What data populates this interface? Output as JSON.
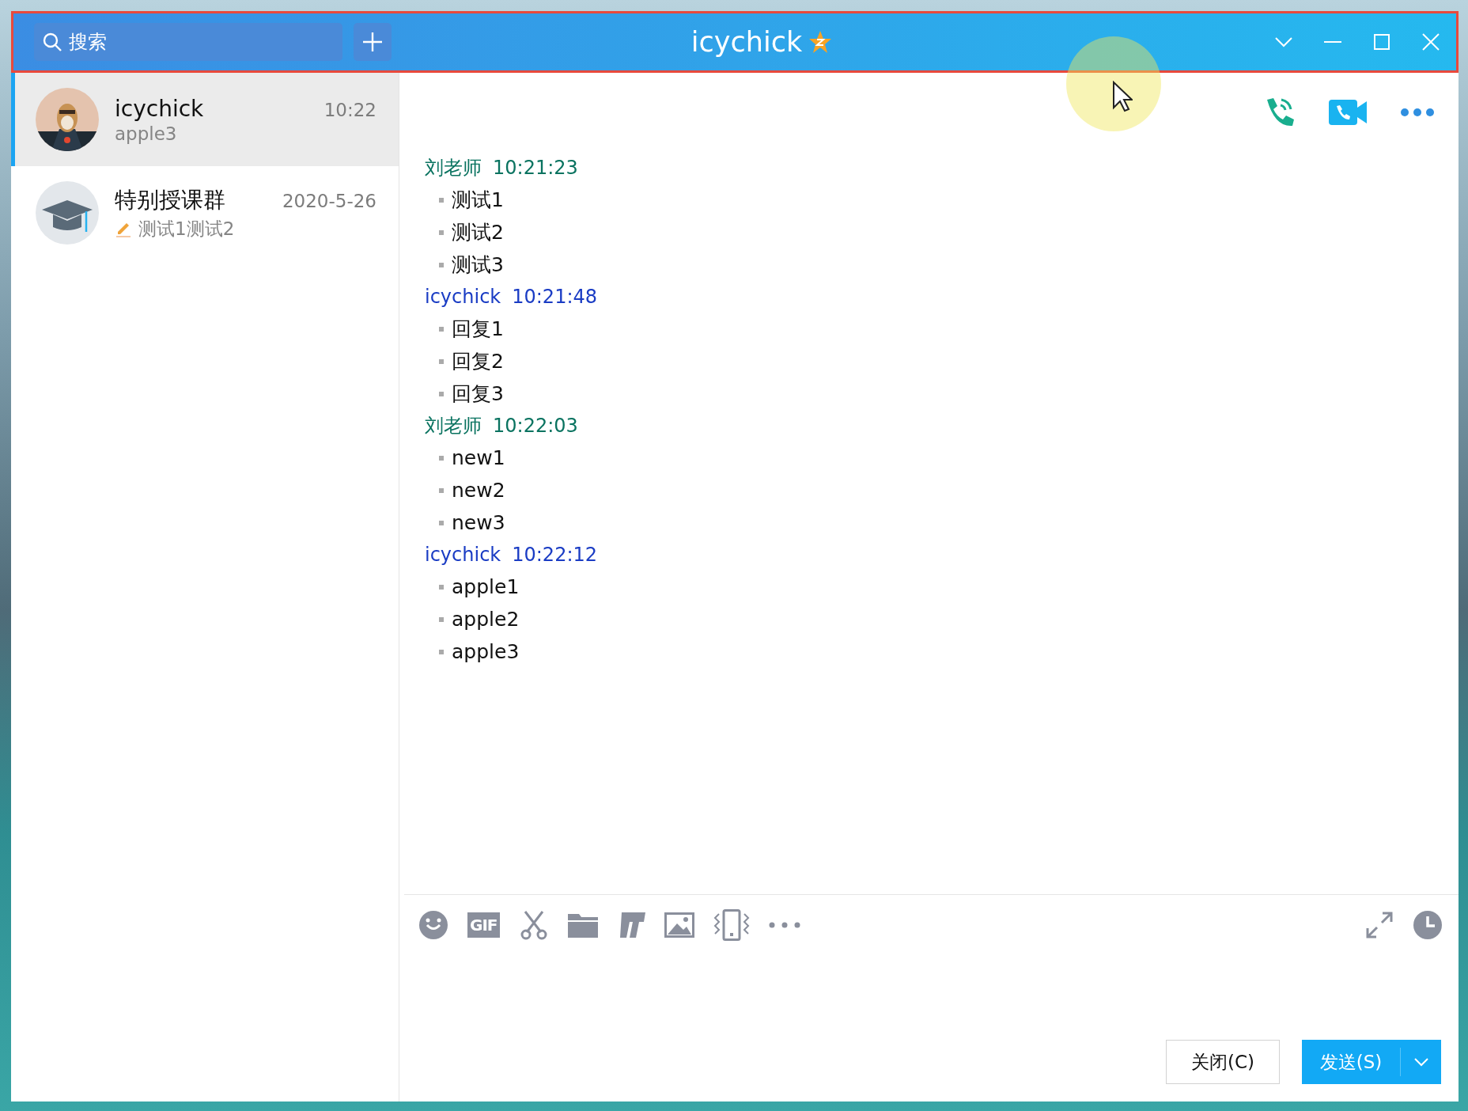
{
  "window": {
    "title": "icychick"
  },
  "search": {
    "placeholder": "搜索"
  },
  "conversations": [
    {
      "name": "icychick",
      "preview": "apple3",
      "time": "10:22",
      "selected": true,
      "kind": "picture",
      "draft": false
    },
    {
      "name": "特别授课群",
      "preview": "测试1测试2",
      "time": "2020-5-26",
      "selected": false,
      "kind": "group",
      "draft": true
    }
  ],
  "messages": [
    {
      "sender": "刘老师",
      "time": "10:21:23",
      "color": "#0a7360",
      "lines": [
        "测试1",
        "测试2",
        "测试3"
      ]
    },
    {
      "sender": "icychick",
      "time": "10:21:48",
      "color": "#1a3cc4",
      "lines": [
        "回复1",
        "回复2",
        "回复3"
      ]
    },
    {
      "sender": "刘老师",
      "time": "10:22:03",
      "color": "#0a7360",
      "lines": [
        "new1",
        "new2",
        "new3"
      ]
    },
    {
      "sender": "icychick",
      "time": "10:22:12",
      "color": "#1a3cc4",
      "lines": [
        "apple1",
        "apple2",
        "apple3"
      ]
    }
  ],
  "toolbar": {
    "gif_label": "GIF"
  },
  "buttons": {
    "close": "关闭(C)",
    "send": "发送(S)"
  }
}
